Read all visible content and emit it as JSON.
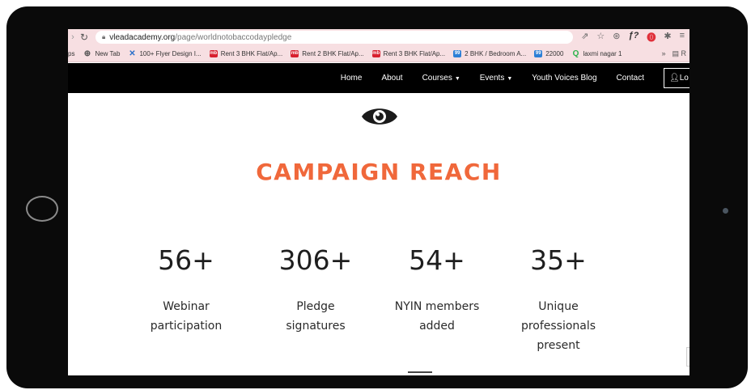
{
  "browser": {
    "url_host": "vleadacademy.org",
    "url_path": "/page/worldnotobaccodaypledge",
    "icons": [
      "share-icon",
      "star-icon",
      "extension-icon",
      "pinterest-icon",
      "puzzle-icon",
      "reading-list-icon"
    ]
  },
  "bookmarks": {
    "items": [
      {
        "label": "ps",
        "icon": "apps-icon"
      },
      {
        "label": "New Tab",
        "icon": "globe-icon"
      },
      {
        "label": "100+ Flyer Design I...",
        "icon": "star-icon"
      },
      {
        "label": "Rent 3 BHK Flat/Ap...",
        "icon": "mb-icon"
      },
      {
        "label": "Rent 2 BHK Flat/Ap...",
        "icon": "mb-icon"
      },
      {
        "label": "Rent 3 BHK Flat/Ap...",
        "icon": "mb-icon"
      },
      {
        "label": "2 BHK / Bedroom A...",
        "icon": "99-icon"
      },
      {
        "label": "22000",
        "icon": "99-icon"
      },
      {
        "label": "laxmi nagar 1",
        "icon": "q-icon"
      }
    ],
    "more": "»",
    "reading_list": "R"
  },
  "navbar": {
    "links": [
      {
        "label": "Home"
      },
      {
        "label": "About"
      },
      {
        "label": "Courses",
        "dropdown": true
      },
      {
        "label": "Events",
        "dropdown": true
      },
      {
        "label": "Youth Voices Blog"
      },
      {
        "label": "Contact"
      }
    ],
    "login": "Lo"
  },
  "page": {
    "headline": "CAMPAIGN REACH",
    "stats": [
      {
        "number": "56+",
        "label_lines": [
          "Webinar",
          "participation"
        ]
      },
      {
        "number": "306+",
        "label_lines": [
          "Pledge",
          "signatures"
        ]
      },
      {
        "number": "54+",
        "label_lines": [
          "NYIN members",
          "added"
        ]
      },
      {
        "number": "35+",
        "label_lines": [
          "Unique",
          "professionals",
          "present"
        ]
      }
    ]
  },
  "colors": {
    "accent": "#f0683b",
    "navbar_bg": "#000000",
    "chrome_bg": "#f7dfe2"
  }
}
